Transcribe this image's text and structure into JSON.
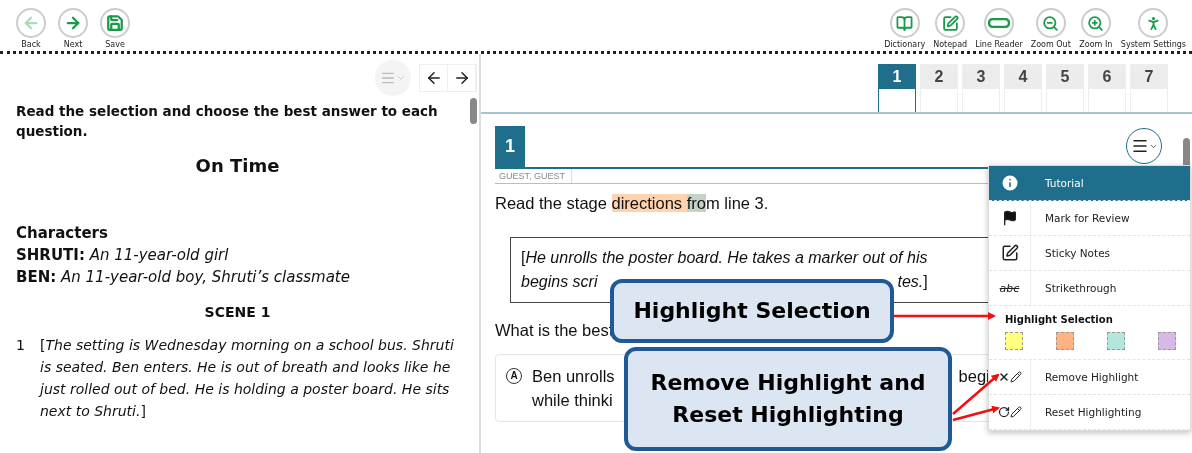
{
  "toolbar_left": [
    {
      "label": "Back",
      "disabled": true
    },
    {
      "label": "Next",
      "disabled": false
    },
    {
      "label": "Save",
      "disabled": false
    }
  ],
  "toolbar_right": [
    {
      "label": "Dictionary"
    },
    {
      "label": "Notepad"
    },
    {
      "label": "Line Reader"
    },
    {
      "label": "Zoom Out"
    },
    {
      "label": "Zoom In"
    },
    {
      "label": "System Settings"
    }
  ],
  "passage": {
    "instructions": "Read the selection and choose the best answer to each question.",
    "title": "On Time",
    "characters_heading": "Characters",
    "characters": [
      {
        "name": "SHRUTI:",
        "description": "An 11-year-old girl"
      },
      {
        "name": "BEN:",
        "description": "An 11-year-old boy, Shruti’s classmate"
      }
    ],
    "scene": "SCENE 1",
    "lines": [
      {
        "number": "1",
        "text": "[*The setting is Wednesday morning on a school bus. Shruti is seated. Ben enters. He is out of breath and looks like he just rolled out of bed. He is holding a poster board. He sits next to Shruti.*]"
      }
    ]
  },
  "question_tabs": [
    {
      "label": "1",
      "selected": true
    },
    {
      "label": "2",
      "selected": false
    },
    {
      "label": "3",
      "selected": false
    },
    {
      "label": "4",
      "selected": false
    },
    {
      "label": "5",
      "selected": false
    },
    {
      "label": "6",
      "selected": false
    },
    {
      "label": "7",
      "selected": false
    }
  ],
  "question": {
    "number": "1",
    "student": "GUEST, GUEST",
    "prompt": [
      {
        "text": "Read the stage "
      },
      {
        "text": "directions ",
        "color": "#ffd3b0"
      },
      {
        "text": "fro",
        "color": "#c3d3c5"
      },
      {
        "text": "m line 3."
      }
    ],
    "stimulus": [
      [
        "[*He unrolls the poster board. He takes a marker out of his*"
      ],
      [
        "*begins scri*",
        "*tes.*]"
      ]
    ],
    "stem": "What is the best",
    "option": {
      "letter": "A",
      "fragments": [
        "Ben unrolls",
        "begi",
        "while thinki"
      ]
    }
  },
  "menu": [
    {
      "kind": "action",
      "label": "Tutorial",
      "selected": true
    },
    {
      "kind": "action",
      "label": "Mark for Review",
      "selected": false
    },
    {
      "kind": "action",
      "label": "Sticky Notes",
      "selected": false
    },
    {
      "kind": "action",
      "label": "Strikethrough",
      "selected": false,
      "icon_text": "abc"
    },
    {
      "kind": "colors",
      "label": "Highlight Selection",
      "colors": [
        {
          "color": "#ffff80"
        },
        {
          "color": "#ffb380"
        },
        {
          "color": "#b3e6dd"
        },
        {
          "color": "#d7b8e6"
        }
      ]
    },
    {
      "kind": "action",
      "label": "Remove Highlight",
      "selected": false
    },
    {
      "kind": "action",
      "label": "Reset Highlighting",
      "selected": false
    }
  ],
  "callouts": [
    {
      "text": "Highlight Selection"
    },
    {
      "text": "Remove Highlight and Reset Highlighting"
    }
  ]
}
